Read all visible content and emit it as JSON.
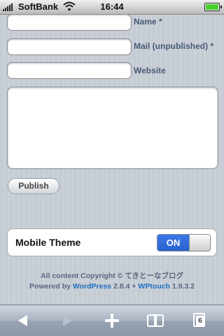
{
  "status_bar": {
    "carrier": "SoftBank",
    "time": "16:44",
    "wifi_icon": "wifi-icon",
    "battery_icon": "battery-icon"
  },
  "form": {
    "name_label": "Name *",
    "name_value": "",
    "mail_label": "Mail (unpublished) *",
    "mail_value": "",
    "website_label": "Website",
    "website_value": "",
    "comment_value": "",
    "publish_label": "Publish"
  },
  "mobile_theme": {
    "label": "Mobile Theme",
    "toggle_label": "ON",
    "state": "on",
    "accent_color": "#2f6fdf"
  },
  "footer": {
    "copyright": "All content Copyright © てきとーなブログ",
    "powered_by_prefix": "Powered by ",
    "wordpress_link": "WordPress",
    "wordpress_version": " 2.8.4 + ",
    "wptouch_link": "WPtouch",
    "wptouch_version": " 1.9.3.2",
    "link_color": "#1f6fc0"
  },
  "toolbar": {
    "back_icon": "back-arrow-icon",
    "forward_icon": "forward-arrow-icon",
    "add_icon": "plus-icon",
    "bookmarks_icon": "bookmarks-icon",
    "pages_icon": "pages-icon",
    "pages_count": "6"
  }
}
